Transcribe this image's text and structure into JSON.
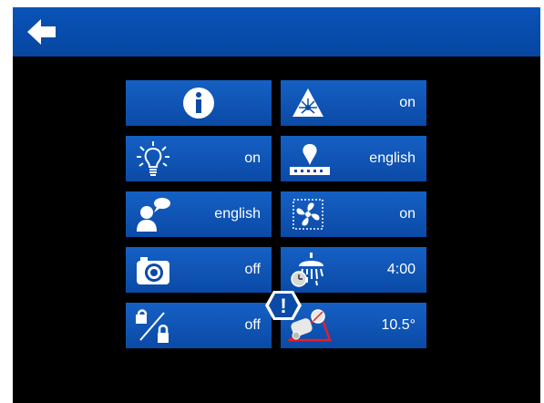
{
  "topbar": {
    "back_icon": "back-arrow-icon"
  },
  "tiles": [
    {
      "icon": "info-icon",
      "value": ""
    },
    {
      "icon": "laser-warning-icon",
      "value": "on"
    },
    {
      "icon": "light-bulb-icon",
      "value": "on"
    },
    {
      "icon": "display-language-icon",
      "value": "english"
    },
    {
      "icon": "voice-language-icon",
      "value": "english"
    },
    {
      "icon": "fan-icon",
      "value": "on"
    },
    {
      "icon": "camera-icon",
      "value": "off"
    },
    {
      "icon": "shower-timer-icon",
      "value": "4:00"
    },
    {
      "icon": "lock-unlock-icon",
      "value": "off"
    },
    {
      "icon": "vehicle-tilt-icon",
      "value": "10.5°"
    }
  ],
  "alert": {
    "icon": "warning-alert-icon",
    "symbol": "!"
  },
  "colors": {
    "tile": "#0b4aa6",
    "topbar": "#0a53b8",
    "screen": "#000000",
    "text": "#ffffff"
  }
}
